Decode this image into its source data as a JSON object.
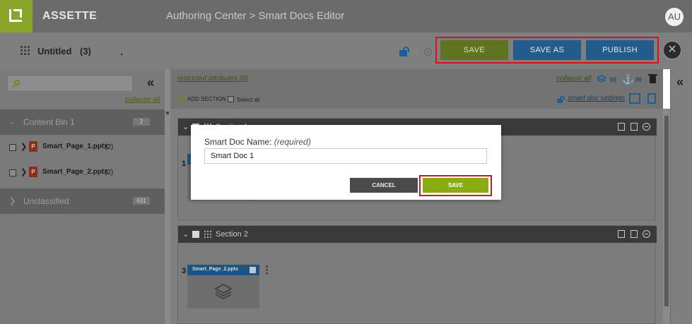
{
  "app": {
    "brand": "ASSETTE",
    "breadcrumb": "Authoring Center > Smart Docs Editor",
    "user_initials": "AU"
  },
  "header": {
    "doc_title": "Untitled",
    "doc_count": "(3)",
    "save_label": "SAVE",
    "save_as_label": "SAVE AS",
    "publish_label": "PUBLISH",
    "close_glyph": "✕"
  },
  "sidebar": {
    "search_placeholder": "",
    "collapse_all": "collapse all",
    "bins": [
      {
        "label": "Content Bin 1",
        "count": "2",
        "files": [
          {
            "name": "Smart_Page_1.pptx",
            "count": "(2)"
          },
          {
            "name": "Smart_Page_2.pptx",
            "count": "(2)"
          }
        ]
      },
      {
        "label": "Unclassified",
        "count": "631"
      }
    ]
  },
  "toolbar": {
    "restricted": "restricted attributes (0)",
    "add_section": "ADD SECTION",
    "select_all": "Select all",
    "collapse_all": "collapse all",
    "layers_count": "(0)",
    "anchor_count": "(0)",
    "smart_doc_settings": "smart doc settings"
  },
  "sections": [
    {
      "title": "Section 1",
      "slide_num": "1"
    },
    {
      "title": "Section 2",
      "slide_num": "3",
      "slide_name": "Smart_Page_2.pptx"
    }
  ],
  "modal": {
    "label": "Smart Doc Name:",
    "required": "(required)",
    "value": "Smart Doc 1",
    "cancel": "CANCEL",
    "save": "SAVE"
  },
  "colors": {
    "green": "#8bab12",
    "blue": "#235c8c",
    "highlight": "#d2141c"
  }
}
